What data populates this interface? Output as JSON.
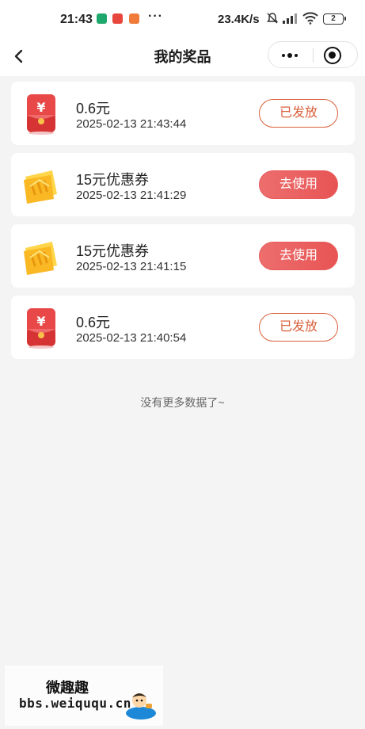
{
  "status_bar": {
    "time": "21:43",
    "more": "···",
    "network_speed": "23.4K/s",
    "battery": "2",
    "icons": [
      "shield-app-icon",
      "netease-music-app-icon",
      "fox-app-icon",
      "mute-bell-icon",
      "hd-signal-icon",
      "wifi-icon",
      "battery-icon"
    ],
    "app_colors": [
      "#1ea86b",
      "#e8453c",
      "#f07a3a"
    ]
  },
  "nav": {
    "title": "我的奖品",
    "back_icon": "chevron-left-icon",
    "more_icon": "more-dots-icon",
    "close_icon": "target-close-icon"
  },
  "prizes": [
    {
      "name": "0.6元",
      "time": "2025-02-13 21:43:44",
      "button": "已发放",
      "icon": "red-envelope-icon",
      "status": "issued"
    },
    {
      "name": "15元优惠券",
      "time": "2025-02-13 21:41:29",
      "button": "去使用",
      "icon": "gold-coupon-icon",
      "status": "use"
    },
    {
      "name": "15元优惠券",
      "time": "2025-02-13 21:41:15",
      "button": "去使用",
      "icon": "gold-coupon-icon",
      "status": "use"
    },
    {
      "name": "0.6元",
      "time": "2025-02-13 21:40:54",
      "button": "已发放",
      "icon": "red-envelope-icon",
      "status": "issued"
    }
  ],
  "no_more_text": "没有更多数据了~",
  "watermark": {
    "name": "微趣趣",
    "url": "bbs.weiququ.cn"
  },
  "colors": {
    "accent": "#e85a5a",
    "issued_border": "#d9603b",
    "background": "#f4f4f4"
  }
}
